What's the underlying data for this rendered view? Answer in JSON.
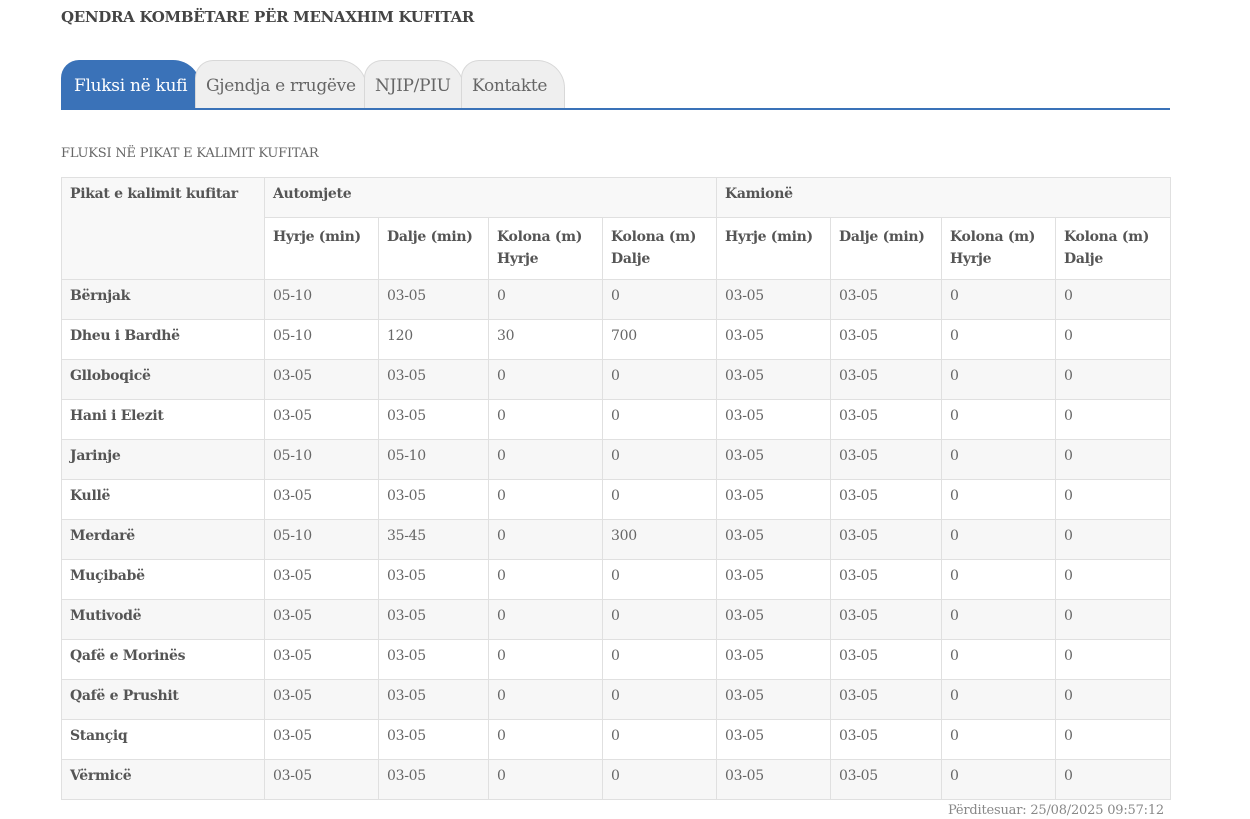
{
  "header": {
    "title": "QENDRA KOMBËTARE PËR MENAXHIM KUFITAR"
  },
  "tabs": [
    {
      "label": "Fluksi në kufi",
      "active": true
    },
    {
      "label": "Gjendja e rrugëve",
      "active": false
    },
    {
      "label": "NJIP/PIU",
      "active": false
    },
    {
      "label": "Kontakte",
      "active": false
    }
  ],
  "section": {
    "title": "FLUKSI NË PIKAT E KALIMIT KUFITAR"
  },
  "table": {
    "corner_header": "Pikat e kalimit kufitar",
    "group_headers": [
      "Automjete",
      "Kamionë"
    ],
    "sub_headers": [
      "Hyrje (min)",
      "Dalje (min)",
      "Kolona (m) Hyrje",
      "Kolona (m) Dalje",
      "Hyrje (min)",
      "Dalje (min)",
      "Kolona (m) Hyrje",
      "Kolona (m) Dalje"
    ],
    "rows": [
      {
        "name": "Bërnjak",
        "values": [
          "05-10",
          "03-05",
          "0",
          "0",
          "03-05",
          "03-05",
          "0",
          "0"
        ]
      },
      {
        "name": "Dheu i Bardhë",
        "values": [
          "05-10",
          "120",
          "30",
          "700",
          "03-05",
          "03-05",
          "0",
          "0"
        ]
      },
      {
        "name": "Glloboqicë",
        "values": [
          "03-05",
          "03-05",
          "0",
          "0",
          "03-05",
          "03-05",
          "0",
          "0"
        ]
      },
      {
        "name": "Hani i Elezit",
        "values": [
          "03-05",
          "03-05",
          "0",
          "0",
          "03-05",
          "03-05",
          "0",
          "0"
        ]
      },
      {
        "name": "Jarinje",
        "values": [
          "05-10",
          "05-10",
          "0",
          "0",
          "03-05",
          "03-05",
          "0",
          "0"
        ]
      },
      {
        "name": "Kullë",
        "values": [
          "03-05",
          "03-05",
          "0",
          "0",
          "03-05",
          "03-05",
          "0",
          "0"
        ]
      },
      {
        "name": "Merdarë",
        "values": [
          "05-10",
          "35-45",
          "0",
          "300",
          "03-05",
          "03-05",
          "0",
          "0"
        ]
      },
      {
        "name": "Muçibabë",
        "values": [
          "03-05",
          "03-05",
          "0",
          "0",
          "03-05",
          "03-05",
          "0",
          "0"
        ]
      },
      {
        "name": "Mutivodë",
        "values": [
          "03-05",
          "03-05",
          "0",
          "0",
          "03-05",
          "03-05",
          "0",
          "0"
        ]
      },
      {
        "name": "Qafë e Morinës",
        "values": [
          "03-05",
          "03-05",
          "0",
          "0",
          "03-05",
          "03-05",
          "0",
          "0"
        ]
      },
      {
        "name": "Qafë e Prushit",
        "values": [
          "03-05",
          "03-05",
          "0",
          "0",
          "03-05",
          "03-05",
          "0",
          "0"
        ]
      },
      {
        "name": "Stançiq",
        "values": [
          "03-05",
          "03-05",
          "0",
          "0",
          "03-05",
          "03-05",
          "0",
          "0"
        ]
      },
      {
        "name": "Vërmicë",
        "values": [
          "03-05",
          "03-05",
          "0",
          "0",
          "03-05",
          "03-05",
          "0",
          "0"
        ]
      }
    ]
  },
  "footer": {
    "updated": "Përditesuar: 25/08/2025 09:57:12"
  },
  "colors": {
    "accent": "#3a72b8",
    "tab_inactive": "#efefef",
    "row_alt": "#f7f7f7"
  }
}
